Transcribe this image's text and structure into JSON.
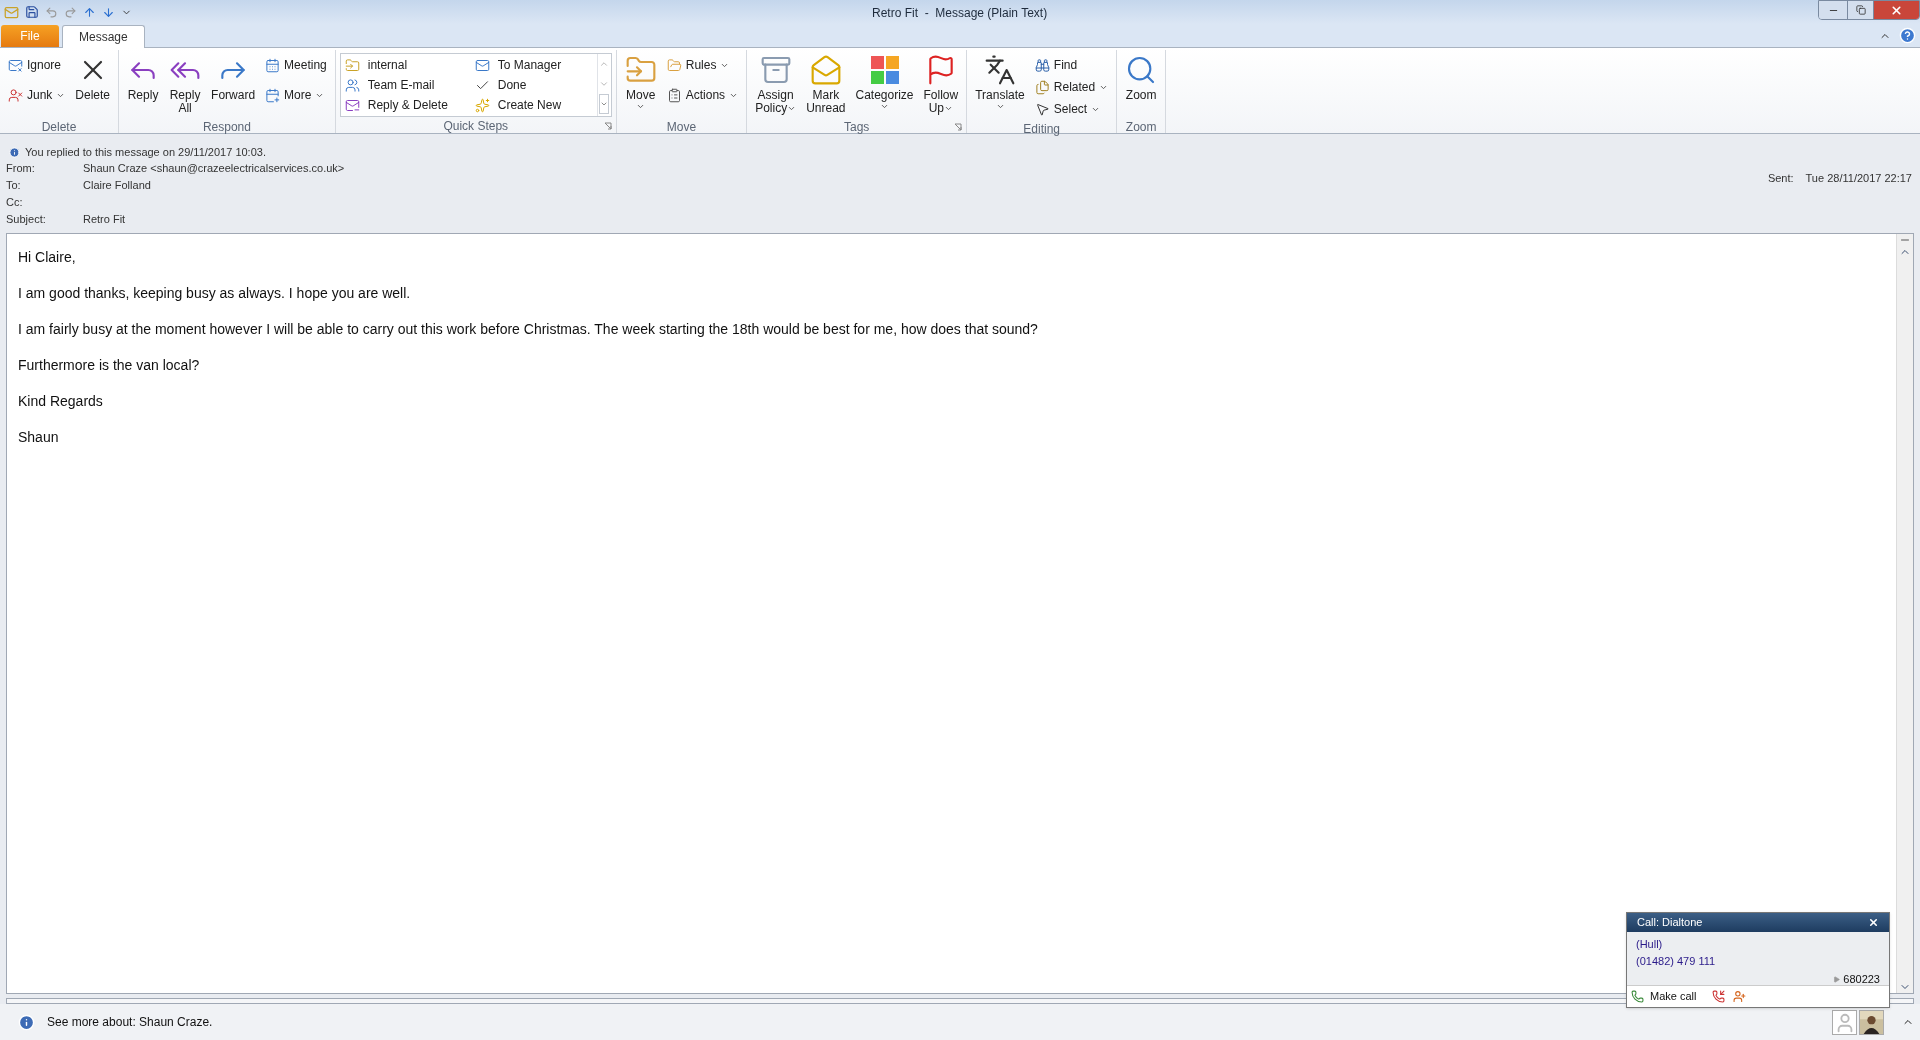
{
  "window": {
    "title": "Retro Fit  -  Message (Plain Text)"
  },
  "tabs": [
    {
      "label": "File",
      "selected": false,
      "kind": "file"
    },
    {
      "label": "Message",
      "selected": true,
      "kind": "tab"
    }
  ],
  "ribbon": {
    "groups": [
      {
        "label": "Delete",
        "launcher": false,
        "items": [
          {
            "label": "Ignore",
            "kind": "small",
            "dropdown": false
          },
          {
            "label": "Junk",
            "kind": "small",
            "dropdown": true
          },
          {
            "label": "Delete",
            "kind": "large",
            "dropdown": false
          }
        ]
      },
      {
        "label": "Respond",
        "launcher": false,
        "items": [
          {
            "label": "Reply",
            "kind": "large",
            "dropdown": false
          },
          {
            "label": "Reply All",
            "kind": "large",
            "dropdown": false
          },
          {
            "label": "Forward",
            "kind": "large",
            "dropdown": false
          },
          {
            "label": "Meeting",
            "kind": "small",
            "dropdown": false
          },
          {
            "label": "More",
            "kind": "small",
            "dropdown": true
          }
        ]
      },
      {
        "label": "Quick Steps",
        "launcher": true,
        "items": [
          {
            "label": "internal",
            "kind": "gallery"
          },
          {
            "label": "Team E-mail",
            "kind": "gallery"
          },
          {
            "label": "Reply & Delete",
            "kind": "gallery"
          },
          {
            "label": "To Manager",
            "kind": "gallery"
          },
          {
            "label": "Done",
            "kind": "gallery"
          },
          {
            "label": "Create New",
            "kind": "gallery"
          }
        ]
      },
      {
        "label": "Move",
        "launcher": false,
        "items": [
          {
            "label": "Move",
            "kind": "large",
            "dropdown": true
          },
          {
            "label": "Rules",
            "kind": "small",
            "dropdown": true
          },
          {
            "label": "Actions",
            "kind": "small",
            "dropdown": true
          }
        ]
      },
      {
        "label": "Tags",
        "launcher": true,
        "items": [
          {
            "label": "Assign Policy",
            "kind": "large",
            "dropdown": true
          },
          {
            "label": "Mark Unread",
            "kind": "large",
            "dropdown": false
          },
          {
            "label": "Categorize",
            "kind": "large",
            "dropdown": true
          },
          {
            "label": "Follow Up",
            "kind": "large",
            "dropdown": true
          }
        ]
      },
      {
        "label": "Editing",
        "launcher": false,
        "items": [
          {
            "label": "Translate",
            "kind": "large",
            "dropdown": true
          },
          {
            "label": "Find",
            "kind": "small",
            "dropdown": false
          },
          {
            "label": "Related",
            "kind": "small",
            "dropdown": true
          },
          {
            "label": "Select",
            "kind": "small",
            "dropdown": true
          }
        ]
      },
      {
        "label": "Zoom",
        "launcher": false,
        "items": [
          {
            "label": "Zoom",
            "kind": "large",
            "dropdown": false
          }
        ]
      }
    ]
  },
  "header": {
    "info": "You replied to this message on 29/11/2017 10:03.",
    "fields": [
      {
        "label": "From:",
        "value": "Shaun Craze <shaun@crazeelectricalservices.co.uk>"
      },
      {
        "label": "To:",
        "value": "Claire Folland"
      },
      {
        "label": "Cc:"
      },
      {
        "label": "Subject:",
        "value": "Retro Fit"
      }
    ],
    "sent": {
      "label": "Sent:",
      "value": "Tue 28/11/2017 22:17"
    }
  },
  "body": [
    "Hi Claire,",
    "I am good thanks, keeping busy as always. I hope you are well.",
    "I am fairly busy at the moment however I will be able to carry out this work before Christmas. The week starting the 18th would be best for me, how does that sound?",
    "Furthermore is the van local?",
    "Kind Regards",
    "Shaun"
  ],
  "call_popup": {
    "title": "Call: Dialtone",
    "location": "(Hull)",
    "number": "(01482) 479 111",
    "extension": "680223",
    "action": "Make call"
  },
  "status_bar": {
    "text": "See more about: Shaun Craze."
  }
}
